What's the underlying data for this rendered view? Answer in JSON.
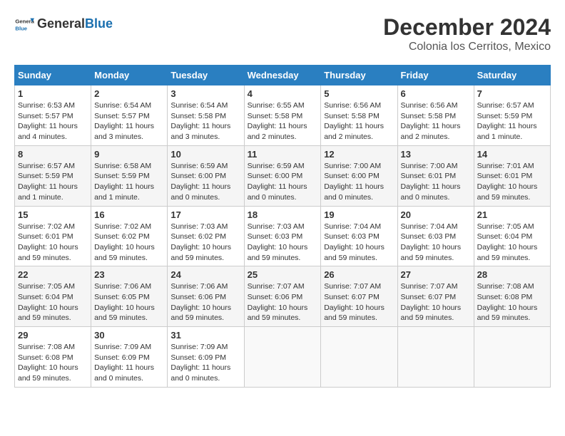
{
  "header": {
    "logo_text_general": "General",
    "logo_text_blue": "Blue",
    "month_year": "December 2024",
    "location": "Colonia los Cerritos, Mexico"
  },
  "calendar": {
    "days_of_week": [
      "Sunday",
      "Monday",
      "Tuesday",
      "Wednesday",
      "Thursday",
      "Friday",
      "Saturday"
    ],
    "weeks": [
      [
        {
          "day": "1",
          "info": "Sunrise: 6:53 AM\nSunset: 5:57 PM\nDaylight: 11 hours and 4 minutes."
        },
        {
          "day": "2",
          "info": "Sunrise: 6:54 AM\nSunset: 5:57 PM\nDaylight: 11 hours and 3 minutes."
        },
        {
          "day": "3",
          "info": "Sunrise: 6:54 AM\nSunset: 5:58 PM\nDaylight: 11 hours and 3 minutes."
        },
        {
          "day": "4",
          "info": "Sunrise: 6:55 AM\nSunset: 5:58 PM\nDaylight: 11 hours and 2 minutes."
        },
        {
          "day": "5",
          "info": "Sunrise: 6:56 AM\nSunset: 5:58 PM\nDaylight: 11 hours and 2 minutes."
        },
        {
          "day": "6",
          "info": "Sunrise: 6:56 AM\nSunset: 5:58 PM\nDaylight: 11 hours and 2 minutes."
        },
        {
          "day": "7",
          "info": "Sunrise: 6:57 AM\nSunset: 5:59 PM\nDaylight: 11 hours and 1 minute."
        }
      ],
      [
        {
          "day": "8",
          "info": "Sunrise: 6:57 AM\nSunset: 5:59 PM\nDaylight: 11 hours and 1 minute."
        },
        {
          "day": "9",
          "info": "Sunrise: 6:58 AM\nSunset: 5:59 PM\nDaylight: 11 hours and 1 minute."
        },
        {
          "day": "10",
          "info": "Sunrise: 6:59 AM\nSunset: 6:00 PM\nDaylight: 11 hours and 0 minutes."
        },
        {
          "day": "11",
          "info": "Sunrise: 6:59 AM\nSunset: 6:00 PM\nDaylight: 11 hours and 0 minutes."
        },
        {
          "day": "12",
          "info": "Sunrise: 7:00 AM\nSunset: 6:00 PM\nDaylight: 11 hours and 0 minutes."
        },
        {
          "day": "13",
          "info": "Sunrise: 7:00 AM\nSunset: 6:01 PM\nDaylight: 11 hours and 0 minutes."
        },
        {
          "day": "14",
          "info": "Sunrise: 7:01 AM\nSunset: 6:01 PM\nDaylight: 10 hours and 59 minutes."
        }
      ],
      [
        {
          "day": "15",
          "info": "Sunrise: 7:02 AM\nSunset: 6:01 PM\nDaylight: 10 hours and 59 minutes."
        },
        {
          "day": "16",
          "info": "Sunrise: 7:02 AM\nSunset: 6:02 PM\nDaylight: 10 hours and 59 minutes."
        },
        {
          "day": "17",
          "info": "Sunrise: 7:03 AM\nSunset: 6:02 PM\nDaylight: 10 hours and 59 minutes."
        },
        {
          "day": "18",
          "info": "Sunrise: 7:03 AM\nSunset: 6:03 PM\nDaylight: 10 hours and 59 minutes."
        },
        {
          "day": "19",
          "info": "Sunrise: 7:04 AM\nSunset: 6:03 PM\nDaylight: 10 hours and 59 minutes."
        },
        {
          "day": "20",
          "info": "Sunrise: 7:04 AM\nSunset: 6:03 PM\nDaylight: 10 hours and 59 minutes."
        },
        {
          "day": "21",
          "info": "Sunrise: 7:05 AM\nSunset: 6:04 PM\nDaylight: 10 hours and 59 minutes."
        }
      ],
      [
        {
          "day": "22",
          "info": "Sunrise: 7:05 AM\nSunset: 6:04 PM\nDaylight: 10 hours and 59 minutes."
        },
        {
          "day": "23",
          "info": "Sunrise: 7:06 AM\nSunset: 6:05 PM\nDaylight: 10 hours and 59 minutes."
        },
        {
          "day": "24",
          "info": "Sunrise: 7:06 AM\nSunset: 6:06 PM\nDaylight: 10 hours and 59 minutes."
        },
        {
          "day": "25",
          "info": "Sunrise: 7:07 AM\nSunset: 6:06 PM\nDaylight: 10 hours and 59 minutes."
        },
        {
          "day": "26",
          "info": "Sunrise: 7:07 AM\nSunset: 6:07 PM\nDaylight: 10 hours and 59 minutes."
        },
        {
          "day": "27",
          "info": "Sunrise: 7:07 AM\nSunset: 6:07 PM\nDaylight: 10 hours and 59 minutes."
        },
        {
          "day": "28",
          "info": "Sunrise: 7:08 AM\nSunset: 6:08 PM\nDaylight: 10 hours and 59 minutes."
        }
      ],
      [
        {
          "day": "29",
          "info": "Sunrise: 7:08 AM\nSunset: 6:08 PM\nDaylight: 10 hours and 59 minutes."
        },
        {
          "day": "30",
          "info": "Sunrise: 7:09 AM\nSunset: 6:09 PM\nDaylight: 11 hours and 0 minutes."
        },
        {
          "day": "31",
          "info": "Sunrise: 7:09 AM\nSunset: 6:09 PM\nDaylight: 11 hours and 0 minutes."
        },
        null,
        null,
        null,
        null
      ]
    ]
  }
}
